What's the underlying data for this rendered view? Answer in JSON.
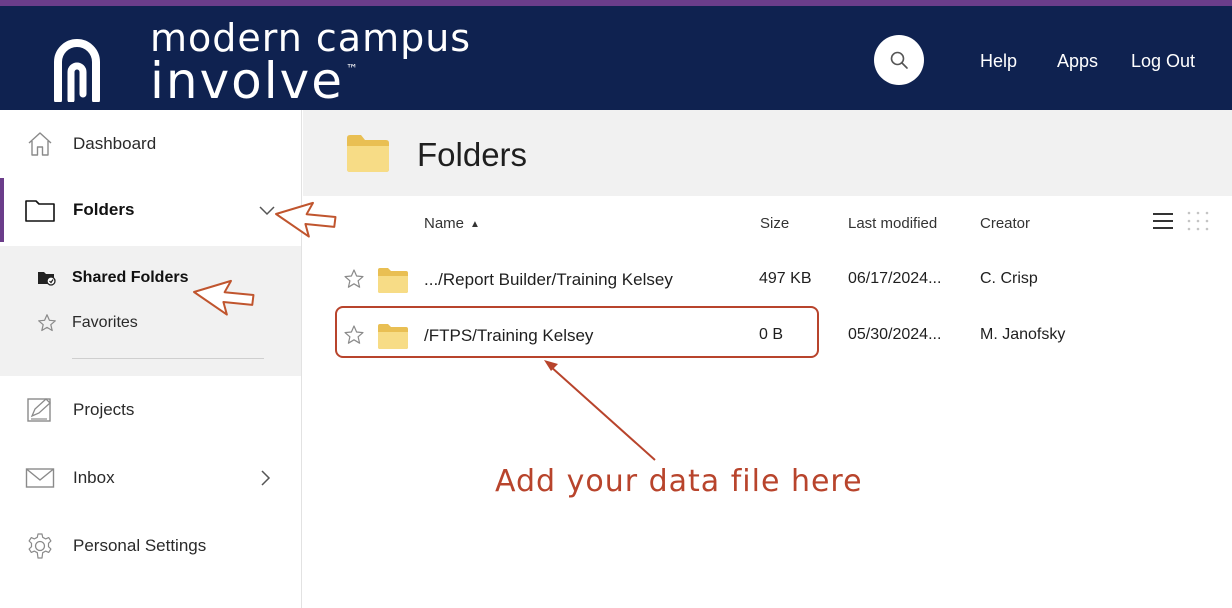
{
  "header": {
    "brand_line1": "modern campus",
    "brand_line2": "involve",
    "brand_tm": "™",
    "links": {
      "help": "Help",
      "apps": "Apps",
      "logout": "Log Out"
    }
  },
  "sidebar": {
    "items": [
      {
        "label": "Dashboard",
        "icon": "home-icon"
      },
      {
        "label": "Folders",
        "icon": "folder-icon",
        "expanded": true
      },
      {
        "label": "Projects",
        "icon": "projects-icon"
      },
      {
        "label": "Inbox",
        "icon": "mail-icon"
      },
      {
        "label": "Personal Settings",
        "icon": "gear-icon"
      }
    ],
    "sub_items": [
      {
        "label": "Shared Folders",
        "icon": "shared-folders-icon",
        "active": true
      },
      {
        "label": "Favorites",
        "icon": "star-icon"
      }
    ]
  },
  "main": {
    "title": "Folders",
    "columns": {
      "name": "Name",
      "size": "Size",
      "modified": "Last modified",
      "creator": "Creator"
    },
    "rows": [
      {
        "name": ".../Report Builder/Training Kelsey",
        "size": "497 KB",
        "modified": "06/17/2024...",
        "creator": "C. Crisp"
      },
      {
        "name": "/FTPS/Training Kelsey",
        "size": "0 B",
        "modified": "05/30/2024...",
        "creator": "M. Janofsky"
      }
    ]
  },
  "annotation": {
    "text": "Add your data file here"
  },
  "colors": {
    "header_bg": "#0f2250",
    "accent": "#6b3d8a",
    "annotation": "#b8442c",
    "folder": "#f3d87a"
  }
}
